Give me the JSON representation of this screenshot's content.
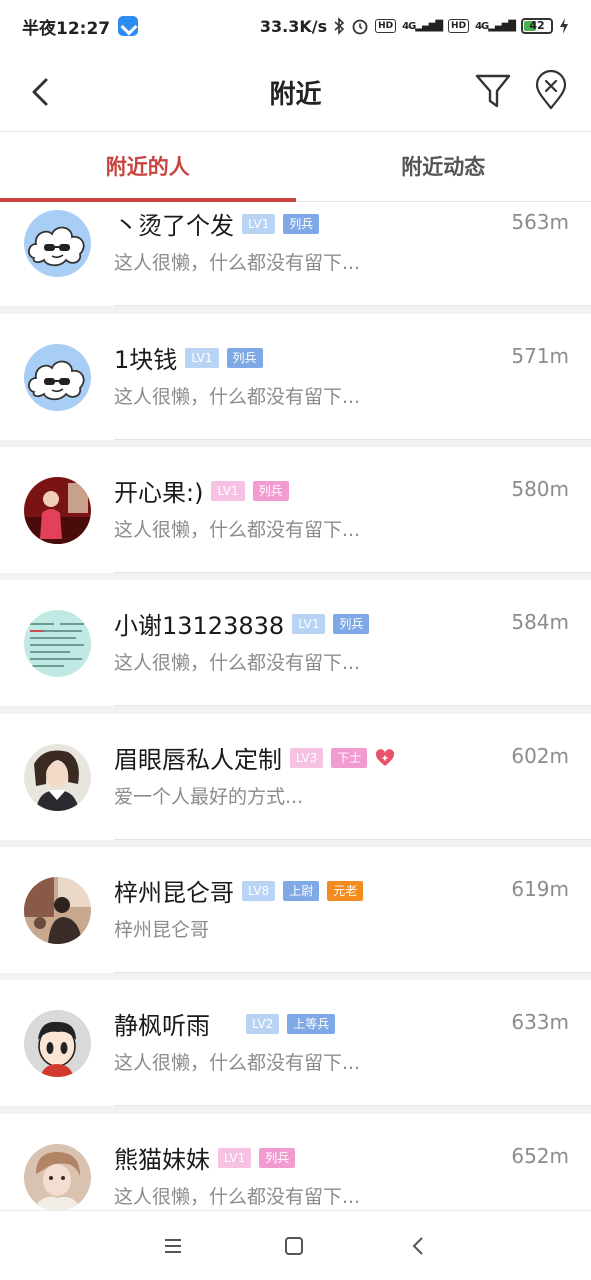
{
  "status_bar": {
    "time": "半夜12:27",
    "speed": "33.3K/s",
    "battery": "42"
  },
  "header": {
    "title": "附近"
  },
  "tabs": [
    {
      "label": "附近的人",
      "active": true
    },
    {
      "label": "附近动态",
      "active": false
    }
  ],
  "users": [
    {
      "name": "丶烫了个发",
      "level": "LV1",
      "rank": "列兵",
      "desc": "这人很懒，什么都没有留下...",
      "distance": "563m",
      "theme": "blue",
      "avatar": "cloud-sunglasses"
    },
    {
      "name": "1块钱",
      "level": "LV1",
      "rank": "列兵",
      "desc": "这人很懒，什么都没有留下...",
      "distance": "571m",
      "theme": "blue",
      "avatar": "cloud-sunglasses"
    },
    {
      "name": "开心果:)",
      "level": "LV1",
      "rank": "列兵",
      "desc": "这人很懒，什么都没有留下...",
      "distance": "580m",
      "theme": "pink",
      "avatar": "photo-red"
    },
    {
      "name": "小谢13123838",
      "level": "LV1",
      "rank": "列兵",
      "desc": "这人很懒，什么都没有留下...",
      "distance": "584m",
      "theme": "blue",
      "avatar": "photo-text"
    },
    {
      "name": "眉眼唇私人定制",
      "level": "LV3",
      "rank": "下士",
      "desc": "爱一个人最好的方式...",
      "distance": "602m",
      "theme": "pink",
      "avatar": "photo-girl",
      "heart": true
    },
    {
      "name": "梓州昆仑哥",
      "level": "LV8",
      "rank": "上尉",
      "extra": "元老",
      "desc": "梓州昆仑哥",
      "distance": "619m",
      "theme": "blue",
      "avatar": "photo-street"
    },
    {
      "name": "静枫听雨",
      "level": "LV2",
      "rank": "上等兵",
      "desc": "这人很懒，什么都没有留下...",
      "distance": "633m",
      "theme": "blue",
      "avatar": "cartoon-boy"
    },
    {
      "name": "熊猫妹妹",
      "level": "LV1",
      "rank": "列兵",
      "desc": "这人很懒，什么都没有留下...",
      "distance": "652m",
      "theme": "pink",
      "avatar": "photo-panda"
    }
  ],
  "icons": {
    "back": "chevron-left-icon",
    "filter": "funnel-icon",
    "clear_location": "location-off-icon"
  },
  "colors": {
    "accent": "#c8433e",
    "lv_blue": "#b9d3f4",
    "rank_blue": "#7fa8e6",
    "lv_pink": "#f6c2e3",
    "rank_pink": "#f29bd0",
    "elder_orange": "#f28c1e"
  }
}
